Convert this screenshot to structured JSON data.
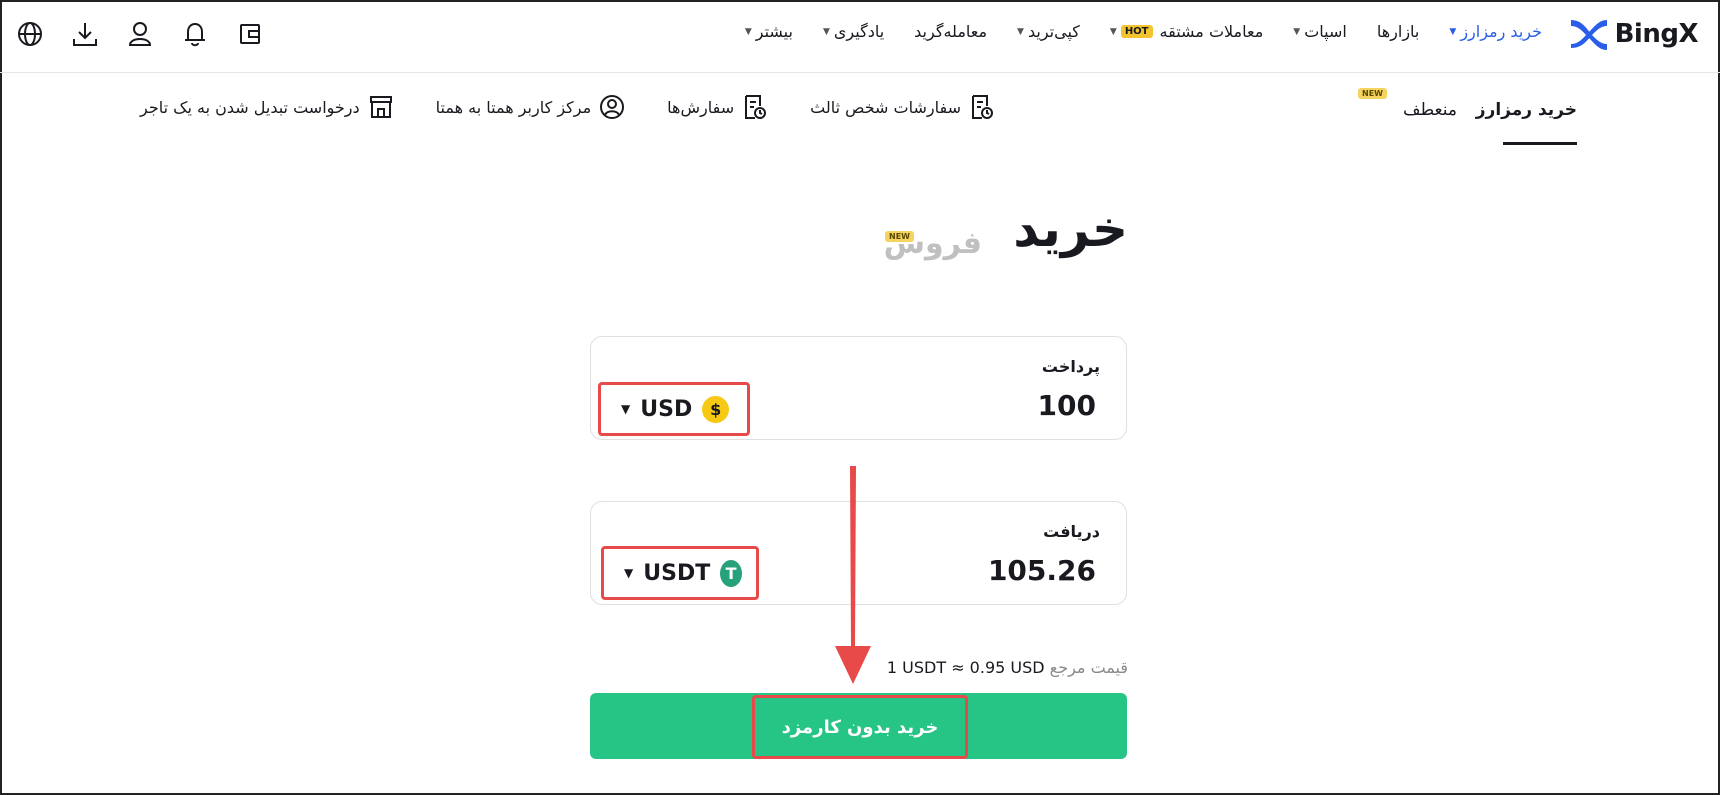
{
  "brand": {
    "name": "BingX",
    "accent": "#2a5ee8"
  },
  "topnav": {
    "items": [
      {
        "label": "خرید رمزارز",
        "has_caret": true,
        "active": true
      },
      {
        "label": "بازارها",
        "has_caret": false
      },
      {
        "label": "اسپات",
        "has_caret": true
      },
      {
        "label": "معاملات مشتقه",
        "has_caret": true,
        "badge": "HOT"
      },
      {
        "label": "کپی‌ترید",
        "has_caret": true
      },
      {
        "label": "معامله‌گرید",
        "has_caret": false
      },
      {
        "label": "یادگیری",
        "has_caret": true
      },
      {
        "label": "بیشتر",
        "has_caret": true
      }
    ],
    "utility_icons": [
      "globe-icon",
      "download-icon",
      "user-icon",
      "bell-icon",
      "wallet-icon"
    ]
  },
  "subnav": {
    "tab_buy": "خرید رمزارز",
    "tab_flex": "منعطف",
    "new_badge": "NEW",
    "links": [
      {
        "label": "درخواست تبدیل شدن به یک تاجر",
        "icon": "store-icon"
      },
      {
        "label": "مرکز کاربر همتا به همتا",
        "icon": "user-circle-icon"
      },
      {
        "label": "سفارش‌ها",
        "icon": "order-icon"
      },
      {
        "label": "سفارشات شخص ثالث",
        "icon": "order-icon"
      }
    ]
  },
  "main": {
    "title_buy": "خرید",
    "title_sell": "فروش",
    "sell_badge": "NEW",
    "pay": {
      "label": "پرداخت",
      "amount": "100",
      "currency": "USD",
      "coin_symbol": "$",
      "coin_color": "#f6c915"
    },
    "receive": {
      "label": "دریافت",
      "amount": "105.26",
      "currency": "USDT",
      "coin_symbol": "T",
      "coin_color": "#26a17b"
    },
    "ref_label": "قیمت مرجع",
    "ref_value": "1 USDT ≈ 0.95 USD",
    "buy_button": "خرید بدون کارمزد"
  },
  "colors": {
    "buy_button": "#26c485",
    "highlight": "#e84a4a"
  }
}
